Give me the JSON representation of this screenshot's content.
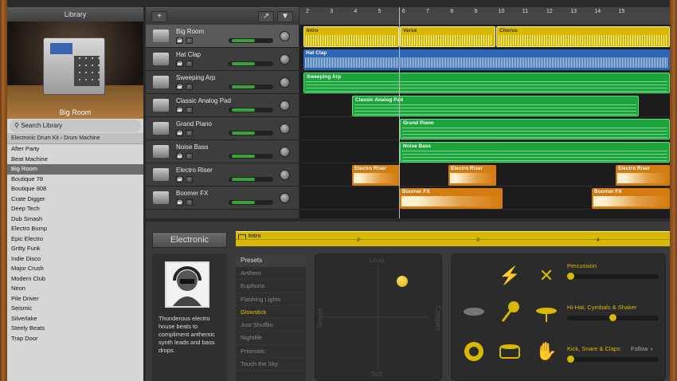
{
  "library": {
    "title": "Library",
    "image_caption": "Big Room",
    "search_placeholder": "Search Library",
    "breadcrumb": [
      "Electronic Drum Kit",
      "Drum Machine"
    ],
    "items": [
      "After Party",
      "Beat Machine",
      "Big Room",
      "Boutique 78",
      "Boutique 808",
      "Crate Digger",
      "Deep Tech",
      "Dub Smash",
      "Electro Bump",
      "Epic Electro",
      "Gritty Funk",
      "Indie Disco",
      "Major Crush",
      "Modern Club",
      "Neon",
      "Pile Driver",
      "Seismic",
      "Silverlake",
      "Steely Beats",
      "Trap Door"
    ],
    "selected": "Big Room"
  },
  "toolbar": {
    "add_label": "+"
  },
  "ruler": {
    "numbers": [
      "2",
      "3",
      "4",
      "5",
      "6",
      "7",
      "8",
      "9",
      "10",
      "11",
      "12",
      "13",
      "14",
      "15"
    ]
  },
  "tracks": [
    {
      "name": "Big Room",
      "icon": "drum-machine-icon",
      "volume": 0.55,
      "selected": true
    },
    {
      "name": "Hat Clap",
      "icon": "drum-machine-icon",
      "volume": 0.55
    },
    {
      "name": "Sweeping Arp",
      "icon": "synth-keyboard-icon",
      "volume": 0.55
    },
    {
      "name": "Classic Analog Pad",
      "icon": "synth-keyboard-icon",
      "volume": 0.55
    },
    {
      "name": "Grand Piano",
      "icon": "piano-icon",
      "volume": 0.55
    },
    {
      "name": "Noise Bass",
      "icon": "synth-module-icon",
      "volume": 0.55
    },
    {
      "name": "Electro Riser",
      "icon": "sparkle-icon",
      "volume": 0.55
    },
    {
      "name": "Boomer FX",
      "icon": "sparkle-icon",
      "volume": 0.55
    }
  ],
  "regions": {
    "intro": "Intro",
    "verse": "Verse",
    "chorus": "Chorus",
    "hat_clap": "Hat Clap",
    "sweeping_arp": "Sweeping Arp",
    "classic_analog_pad": "Classic Analog Pad",
    "grand_piano": "Grand Piano",
    "noise_bass": "Noise Bass",
    "electro_riser": "Electro Riser",
    "boomer_fx": "Boomer FX"
  },
  "editor": {
    "title": "Electronic",
    "drummer_description": "Thunderous electro house beats to compliment anthemic synth leads and bass drops.",
    "region_label": "Intro",
    "bar_numbers": [
      "2",
      "3",
      "4"
    ],
    "presets_header": "Presets",
    "presets": [
      "Anthem",
      "Euphoria",
      "Flashing Lights",
      "Glowstick",
      "Just Shufflin",
      "Nightlife",
      "Prismatic",
      "Touch the Sky"
    ],
    "selected_preset": "Glowstick",
    "xy_labels": {
      "top": "Loud",
      "bottom": "Soft",
      "left": "Simple",
      "right": "Complex"
    },
    "xy_puck": {
      "complexity": 0.72,
      "loudness": 0.85
    },
    "sliders": [
      {
        "label": "Percussion",
        "value": 0.0
      },
      {
        "label": "Hi-Hat, Cymbals & Shaker",
        "value": 0.5
      },
      {
        "label": "Kick, Snare & Claps",
        "value": 0.0
      }
    ],
    "follow_label": "Follow"
  },
  "colors": {
    "accent": "#d8b800",
    "green_region": "#1ea43c",
    "blue_region": "#2e66b8",
    "orange_region": "#d57c10"
  }
}
